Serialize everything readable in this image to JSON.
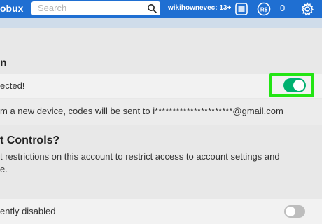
{
  "topbar": {
    "brand": "obux",
    "search_placeholder": "Search",
    "username": "wikihownevec: 13+",
    "robux_count": "0",
    "icons": [
      "search-icon",
      "notifications-icon",
      "robux-icon",
      "settings-gear-icon"
    ],
    "colors": {
      "bar": "#1f6fd2",
      "toggle_on": "#00b06f",
      "highlight": "#23e514"
    }
  },
  "two_step": {
    "heading_fragment": "n",
    "status_text": "ected!",
    "toggle_state": "on",
    "info_text": "m a new device, codes will be sent to i**********************@gmail.com"
  },
  "account_controls": {
    "heading_fragment": "t Controls?",
    "desc_line1": "t restrictions on this account to restrict access to account settings and",
    "desc_line2": "e."
  },
  "setting_row": {
    "label": "ently disabled",
    "toggle_state": "off"
  }
}
